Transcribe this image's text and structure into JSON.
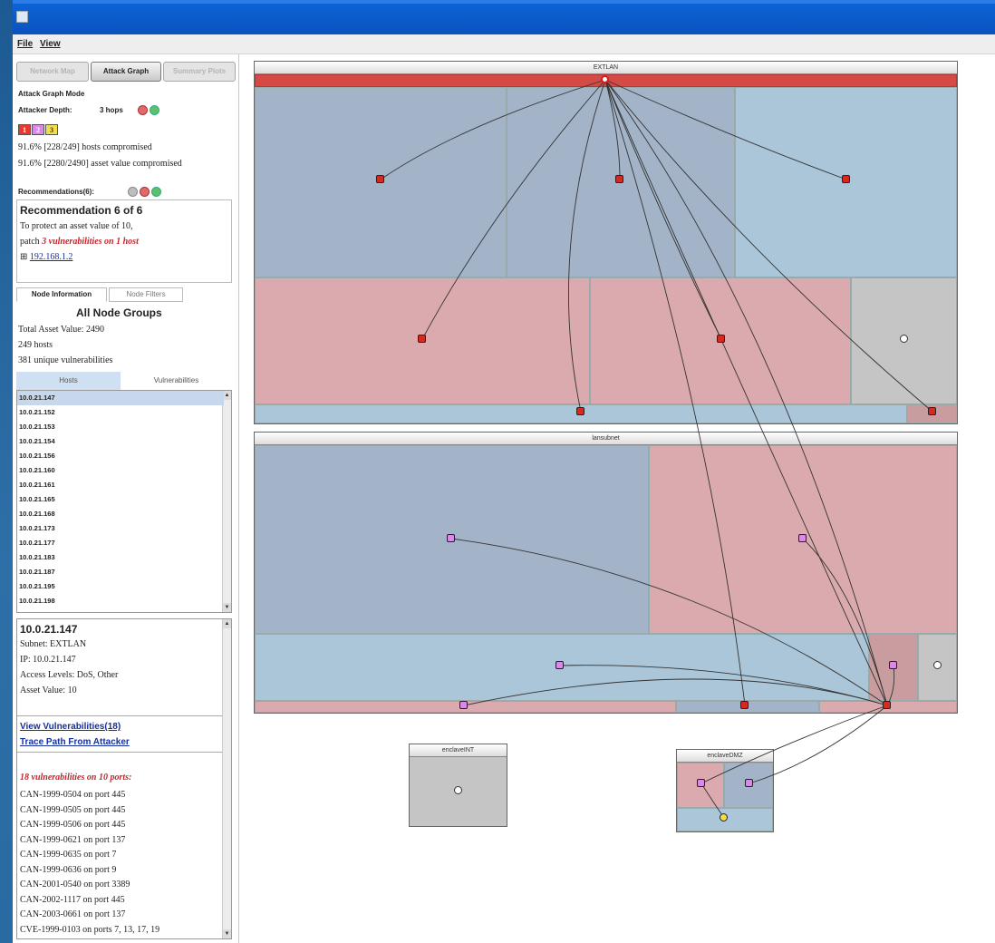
{
  "menu": {
    "file": "File",
    "view": "View"
  },
  "mode_tabs": {
    "network_map": "Network Map",
    "attack_graph": "Attack Graph",
    "summary_plots": "Summary Plots"
  },
  "attack_mode": {
    "title": "Attack Graph Mode",
    "depth_label": "Attacker Depth:",
    "depth_value": "3 hops",
    "depth_boxes": [
      "1",
      "2",
      "3"
    ],
    "hosts_compromised": "91.6% [228/249] hosts compromised",
    "asset_compromised": "91.6% [2280/2490] asset value compromised"
  },
  "recommendations": {
    "label": "Recommendations(6):",
    "count": "6",
    "title": "Recommendation 6 of 6",
    "line1": "To protect an asset value of 10,",
    "patch_prefix": "patch ",
    "patch_emphasis": "3 vulnerabilities on 1 host",
    "host_link": "192.168.1.2",
    "expand_glyph": "⊞"
  },
  "node_tabs": {
    "info": "Node Information",
    "filters": "Node Filters"
  },
  "node_summary": {
    "title": "All Node Groups",
    "total_asset": "Total Asset Value: 2490",
    "hosts": "249 hosts",
    "unique_vulns": "381 unique vulnerabilities"
  },
  "list_tabs": {
    "hosts": "Hosts",
    "vulns": "Vulnerabilities"
  },
  "hosts": [
    "10.0.21.147",
    "10.0.21.152",
    "10.0.21.153",
    "10.0.21.154",
    "10.0.21.156",
    "10.0.21.160",
    "10.0.21.161",
    "10.0.21.165",
    "10.0.21.168",
    "10.0.21.173",
    "10.0.21.177",
    "10.0.21.183",
    "10.0.21.187",
    "10.0.21.195",
    "10.0.21.198"
  ],
  "host_detail": {
    "ip_title": "10.0.21.147",
    "subnet": "Subnet: EXTLAN",
    "ip": "IP: 10.0.21.147",
    "access": "Access Levels: DoS, Other",
    "asset": "Asset Value: 10",
    "view_link": "View Vulnerabilities(18)",
    "trace_link": "Trace Path From Attacker",
    "vuln_summary": "18 vulnerabilities on 10 ports:",
    "vulns": [
      "CAN-1999-0504 on port 445",
      "CAN-1999-0505 on port 445",
      "CAN-1999-0506 on port 445",
      "CAN-1999-0621 on port 137",
      "CAN-1999-0635 on port 7",
      "CAN-1999-0636 on port 9",
      "CAN-2001-0540 on port 3389",
      "CAN-2002-1117 on port 445",
      "CAN-2003-0661 on port 137",
      "CVE-1999-0103 on ports 7, 13, 17, 19"
    ]
  },
  "subnets": {
    "extlan": "EXTLAN",
    "lansubnet": "lansubnet",
    "enclave_int": "enclaveINT",
    "enclave_dmz": "enclaveDMZ"
  },
  "colors": {
    "blue_dark": "#a3b3c8",
    "blue_light": "#abc6d8",
    "pink": "#dbaaae",
    "gray": "#c5c5c5",
    "red_node": "#d42a20",
    "purple_node": "#d98ae8",
    "yellow_node": "#f2dd4a"
  },
  "icons": {
    "red_circle": "red-circle-icon",
    "green_circle": "green-circle-icon",
    "gray_circle": "gray-circle-icon"
  }
}
